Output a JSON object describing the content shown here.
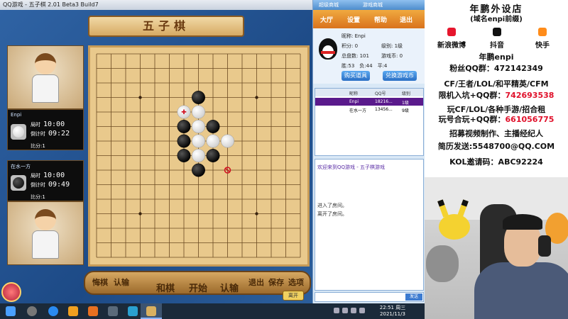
{
  "window": {
    "title": "QQ游戏 - 五子棋  2.01 Beta3 Build7"
  },
  "banner": "五子棋",
  "players": [
    {
      "name": "Enpi",
      "timer_label": "局时",
      "timer": "10:00",
      "countdown_label": "倒计时",
      "countdown": "09:22",
      "score_label": "比分",
      "score": "1",
      "stone": "white"
    },
    {
      "name": "在水一方",
      "timer_label": "局时",
      "timer": "10:00",
      "countdown_label": "倒计时",
      "countdown": "09:49",
      "score_label": "比分",
      "score": "1",
      "stone": "black"
    }
  ],
  "board": {
    "size": 15,
    "stones": [
      {
        "row": 3,
        "col": 7,
        "color": "black"
      },
      {
        "row": 4,
        "col": 6,
        "color": "white",
        "marked": true
      },
      {
        "row": 4,
        "col": 7,
        "color": "white"
      },
      {
        "row": 5,
        "col": 6,
        "color": "black"
      },
      {
        "row": 5,
        "col": 7,
        "color": "white"
      },
      {
        "row": 5,
        "col": 8,
        "color": "black"
      },
      {
        "row": 6,
        "col": 6,
        "color": "black"
      },
      {
        "row": 6,
        "col": 7,
        "color": "white"
      },
      {
        "row": 6,
        "col": 8,
        "color": "white"
      },
      {
        "row": 6,
        "col": 9,
        "color": "white"
      },
      {
        "row": 7,
        "col": 6,
        "color": "black"
      },
      {
        "row": 7,
        "col": 7,
        "color": "white"
      },
      {
        "row": 7,
        "col": 8,
        "color": "black"
      },
      {
        "row": 8,
        "col": 7,
        "color": "black"
      }
    ],
    "forbidden": [
      {
        "row": 8,
        "col": 9
      }
    ],
    "star_points": [
      {
        "row": 3,
        "col": 3
      },
      {
        "row": 3,
        "col": 11
      },
      {
        "row": 7,
        "col": 7
      },
      {
        "row": 11,
        "col": 3
      },
      {
        "row": 11,
        "col": 11
      }
    ]
  },
  "bottom_buttons": [
    "悔棋",
    "认输",
    "和棋",
    "开始",
    "认输",
    "退出",
    "保存",
    "选项"
  ],
  "exit_button": "离开",
  "lobby": {
    "top_links": [
      "超级商城",
      "游戏商城"
    ],
    "nav": [
      "大厅",
      "设置",
      "帮助",
      "退出"
    ],
    "profile": {
      "nickname_label": "昵称",
      "nickname": "Enpi",
      "points_label": "积分",
      "points": "0",
      "level_label": "级别",
      "level": "1级",
      "total_label": "总盘数",
      "total": "101",
      "coins_label": "游戏币",
      "coins": "0",
      "win_label": "胜",
      "win": "53",
      "lose_label": "负",
      "lose": "44",
      "draw_label": "平",
      "draw": "4",
      "buy_button": "购买道具",
      "exchange_button": "兑换游戏币"
    },
    "table_headers": [
      "昵称",
      "QQ号",
      "级别"
    ],
    "table_rows": [
      {
        "name": "Enpi",
        "qq": "18216...",
        "level": "1级"
      },
      {
        "name": "在水一方",
        "qq": "13456...",
        "level": "9级"
      }
    ],
    "chat": [
      {
        "text": "欢迎来到QQ游戏 - 五子棋游戏",
        "color": "#5b2ea6"
      },
      {
        "text": "进入了房间。",
        "color": "#333333"
      },
      {
        "text": "离开了房间。",
        "color": "#333333"
      }
    ],
    "send_label": "发送"
  },
  "streamer": {
    "title": "年鹏外设店",
    "subtitle": "(域名enpi前缀)",
    "social": [
      {
        "label": "新浪微博",
        "color": "#e6162d"
      },
      {
        "label": "抖音",
        "color": "#111111"
      },
      {
        "label": "快手",
        "color": "#ff8c1a"
      }
    ],
    "handle": "年鹏enpi",
    "fan_group_label": "粉丝QQ群：",
    "fan_group": "472142349",
    "line1": "CF/王者/LOL/和平精英/CFM",
    "line2_label": "限机入坑+QQ群：",
    "line2_value": "742693538",
    "line3": "玩CF/LOL/各种手游/招合租",
    "line4_label": "玩号合玩+QQ群：",
    "line4_value": "661056775",
    "line5": "招募视频制作、主播经纪人",
    "line6": "简历发送:5548700@QQ.COM",
    "line7": "KOL邀请码：ABC92224"
  },
  "taskbar": {
    "time": "22:51 周三",
    "date": "2021/11/3"
  }
}
